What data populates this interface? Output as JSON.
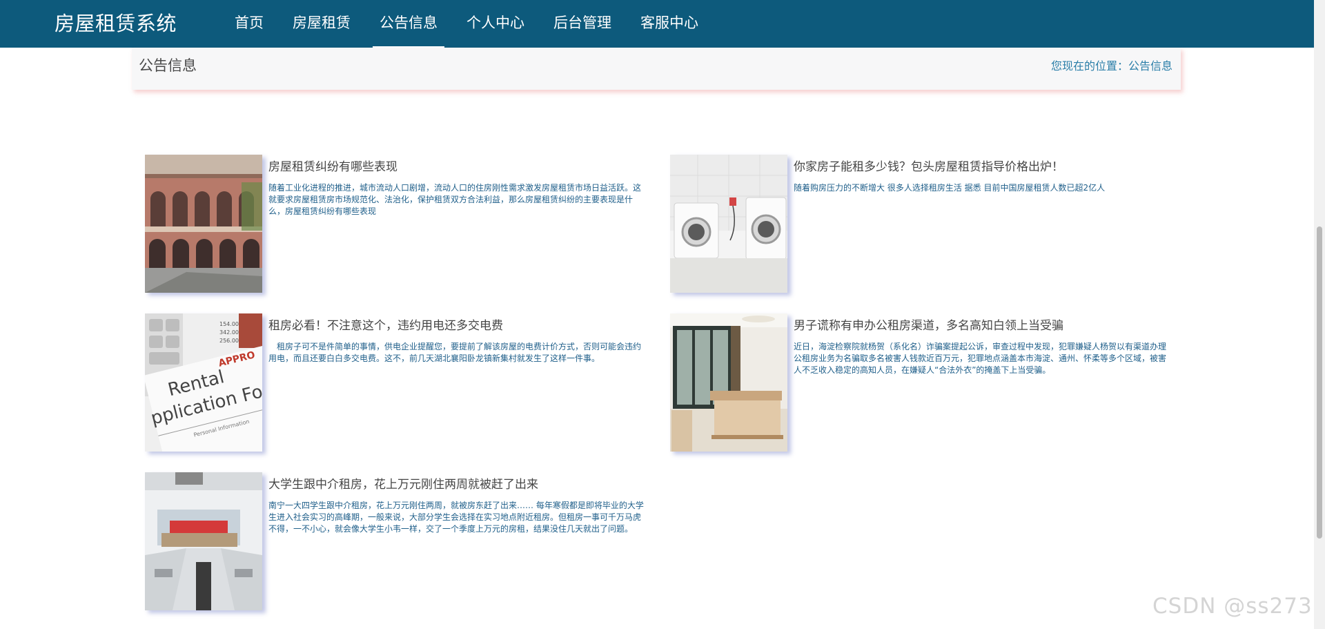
{
  "header": {
    "brand": "房屋租赁系统",
    "nav": [
      {
        "label": "首页"
      },
      {
        "label": "房屋租赁"
      },
      {
        "label": "公告信息"
      },
      {
        "label": "个人中心"
      },
      {
        "label": "后台管理"
      },
      {
        "label": "客服中心"
      }
    ],
    "active_index": 2
  },
  "breadcrumb": {
    "title": "公告信息",
    "prefix": "您现在的位置：",
    "current": "公告信息"
  },
  "notices": [
    {
      "title": "房屋租赁纠纷有哪些表现",
      "desc": "随着工业化进程的推进，城市流动人口剧增，流动人口的住房刚性需求激发房屋租赁市场日益活跃。这就要求房屋租赁房市场规范化、法治化，保护租赁双方合法利益，那么房屋租赁纠纷的主要表现是什么，房屋租赁纠纷有哪些表现",
      "image": "building-arcade-photo"
    },
    {
      "title": "你家房子能租多少钱？包头房屋租赁指导价格出炉！",
      "desc": "随着购房压力的不断增大 很多人选择租房生活 据悉 目前中国房屋租赁人数已超2亿人",
      "image": "washing-machines-photo"
    },
    {
      "title": "租房必看！不注意这个，违约用电还多交电费",
      "desc": "　租房子可不是件简单的事情，供电企业提醒您，要提前了解该房屋的电费计价方式，否则可能会违约用电，而且还要白白多交电费。这不，前几天湖北襄阳卧龙镇新集村就发生了这样一件事。",
      "image": "rental-application-form-photo"
    },
    {
      "title": "男子谎称有申办公租房渠道，多名高知白领上当受骗",
      "desc": "近日，海淀检察院就杨贺（系化名）诈骗案提起公诉，审查过程中发现，犯罪嫌疑人杨贺以有渠道办理公租房业务为名骗取多名被害人钱款近百万元，犯罪地点涵盖本市海淀、通州、怀柔等多个区域，被害人不乏收入稳定的高知人员，在嫌疑人“合法外衣”的掩盖下上当受骗。",
      "image": "bedroom-photo"
    },
    {
      "title": "大学生跟中介租房，花上万元刚住两周就被赶了出来",
      "desc": "南宁一大四学生跟中介租房，花上万元刚住两周，就被房东赶了出来…… 每年寒假都是即将毕业的大学生进入社会实习的高峰期，一般来说，大部分学生会选择在实习地点附近租房。但租房一事可千万马虎不得，一不小心，就会像大学生小韦一样，交了一个季度上万元的房租，结果没住几天就出了问题。",
      "image": "kitchen-photo"
    }
  ],
  "watermark": "CSDN @ss273"
}
